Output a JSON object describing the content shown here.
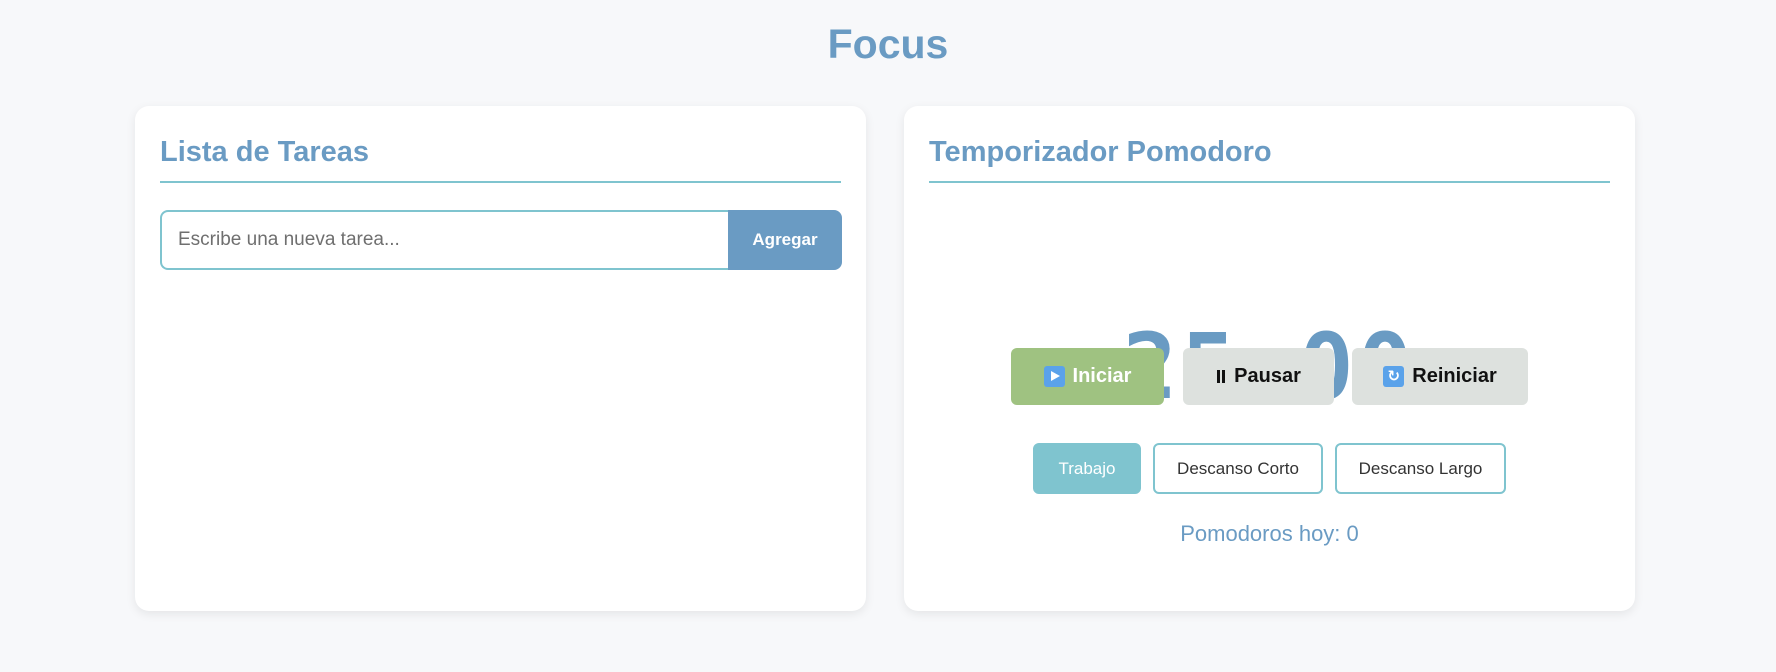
{
  "app": {
    "title": "Focus"
  },
  "tasks": {
    "title": "Lista de Tareas",
    "input_value": "",
    "input_placeholder": "Escribe una nueva tarea...",
    "add_label": "Agregar",
    "items": []
  },
  "pomodoro": {
    "title": "Temporizador Pomodoro",
    "timer": "25:00",
    "controls": {
      "start_label": "Iniciar",
      "start_icon": "play-icon",
      "pause_label": "Pausar",
      "pause_icon": "pause-icon",
      "reset_label": "Reiniciar",
      "reset_icon": "reset-icon"
    },
    "modes": [
      {
        "label": "Trabajo",
        "active": true
      },
      {
        "label": "Descanso Corto",
        "active": false
      },
      {
        "label": "Descanso Largo",
        "active": false
      }
    ],
    "count_text": "Pomodoros hoy: 0"
  },
  "colors": {
    "accent": "#6a9bc3",
    "teal": "#7fc4cf",
    "start_green": "#9fc281",
    "neutral_button": "#dde1de",
    "background": "#f7f8fa"
  }
}
